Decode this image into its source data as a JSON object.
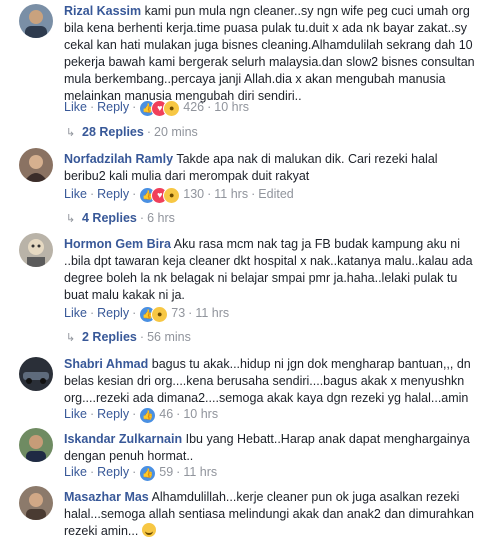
{
  "comments": [
    {
      "author": "Rizal Kassim",
      "text": "kami pun mula ngn cleaner..sy ngn wife peg cuci umah org bila kena berhenti kerja.time puasa pulak tu.duit x ada nk bayar zakat..sy cekal kan hati mulakan juga bisnes cleaning.Alhamdulilah sekrang dah 10 pekerja bawah kami bergerak selurh malaysia.dan slow2 bisnes consultan mula berkembang..percaya janji Allah.dia x akan mengubah manusia melainkan manusia mengubah diri sendiri..",
      "like": "Like",
      "reply": "Reply",
      "reaction_count": "426",
      "time": "10 hrs",
      "replies_label": "28 Replies",
      "replies_time": "20 mins"
    },
    {
      "author": "Norfadzilah Ramly",
      "text": "Takde apa nak di malukan dik. Cari rezeki halal beribu2 kali mulia dari merompak duit rakyat",
      "like": "Like",
      "reply": "Reply",
      "reaction_count": "130",
      "time": "11 hrs",
      "edited": "Edited",
      "replies_label": "4 Replies",
      "replies_time": "6 hrs"
    },
    {
      "author": "Hormon Gem Bira",
      "text": "Aku rasa mcm nak tag ja FB budak kampung aku ni ..bila dpt tawaran keja cleaner dkt hospital x nak..katanya malu..kalau ada degree boleh la nk belagak ni belajar smpai pmr ja.haha..lelaki pulak tu buat malu kakak ni ja.",
      "like": "Like",
      "reply": "Reply",
      "reaction_count": "73",
      "time": "11 hrs",
      "replies_label": "2 Replies",
      "replies_time": "56 mins"
    },
    {
      "author": "Shabri Ahmad",
      "text": "bagus tu akak...hidup ni jgn dok mengharap bantuan,,, dn belas kesian dri org....kena berusaha sendiri....bagus akak x menyushkn org....rezeki ada dimana2....semoga akak kaya dgn rezeki yg halal...amin",
      "like": "Like",
      "reply": "Reply",
      "reaction_count": "46",
      "time": "10 hrs"
    },
    {
      "author": "Iskandar Zulkarnain",
      "text": "Ibu yang Hebatt..Harap anak dapat menghargainya dengan penuh hormat..",
      "like": "Like",
      "reply": "Reply",
      "reaction_count": "59",
      "time": "11 hrs"
    },
    {
      "author": "Masazhar Mas",
      "text": "Alhamdulillah...kerje cleaner pun ok juga asalkan rezeki halal...semoga allah sentiasa melindungi akak dan anak2 dan dimurahkan rezeki amin...",
      "emoji": "smile-emoji"
    }
  ],
  "colors": {
    "author": "#385898",
    "text": "#1d2129",
    "meta": "#90949c",
    "like_reaction": "#4a90e2",
    "love_reaction": "#f0405b",
    "haha_reaction": "#f7c744"
  }
}
